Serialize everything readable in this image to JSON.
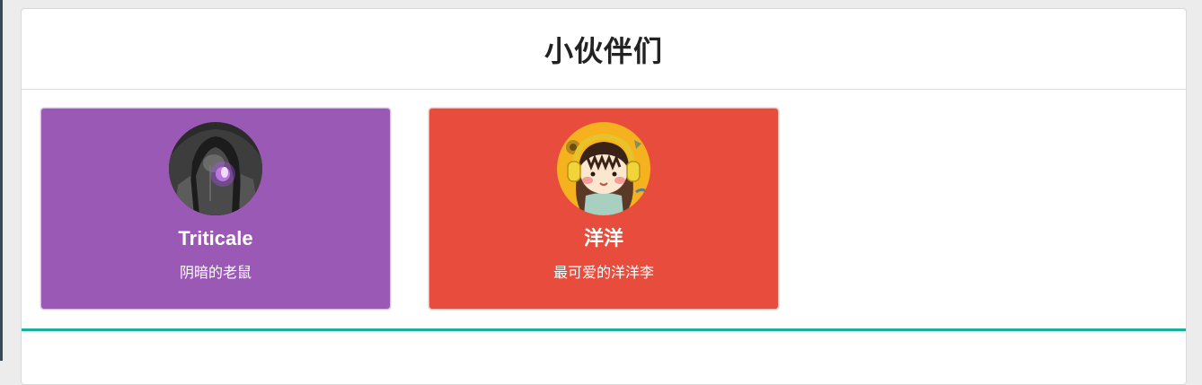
{
  "page": {
    "title": "小伙伴们",
    "background_color": "#ececec",
    "accent_color": "#1aaf9d"
  },
  "friends": [
    {
      "name": "Triticale",
      "description": "阴暗的老鼠",
      "color": "#9b59b6",
      "avatar_icon": "dark-hooded-figure-avatar"
    },
    {
      "name": "洋洋",
      "description": "最可爱的洋洋李",
      "color": "#e74c3c",
      "avatar_icon": "cartoon-girl-headphones-avatar"
    }
  ],
  "footer": {
    "text": ""
  }
}
